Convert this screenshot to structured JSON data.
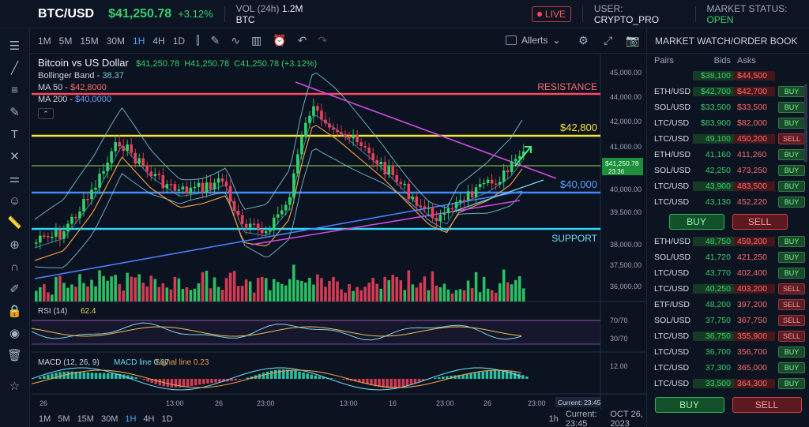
{
  "topbar": {
    "symbol": "BTC/USD",
    "price": "$41,250.78",
    "change": "+3.12%",
    "vol_label": "VOL (24h)",
    "vol_value": "1.2M BTC",
    "live": "LIVE",
    "user_label": "USER:",
    "user_value": "CRYPTO_PRO",
    "status_label": "MARKET STATUS:",
    "status_value": "OPEN"
  },
  "timeframes": [
    "1M",
    "5M",
    "15M",
    "30M",
    "1H",
    "4H",
    "1D"
  ],
  "active_timeframe": "1H",
  "alerts_label": "Allerts",
  "legend": {
    "title": "Bitcoin vs US Dollar",
    "price": "$41,250.78",
    "high": "H41,250.78",
    "close": "C41,250.78 (+3.12%)",
    "bb_label": "Bollinger Band -",
    "bb_value": "38.37",
    "ma50_label": "MA 50 -",
    "ma50_value": "$42,8000",
    "ma200_label": "MA 200 -",
    "ma200_value": "$40,0000"
  },
  "chart_data": {
    "type": "candlestick",
    "y_ticks": [
      "45,000.00",
      "44,000.00",
      "42,000.00",
      "41,000.00",
      "40,000.00",
      "39,500.00",
      "38,000.00",
      "37,500.00",
      "36,000.00"
    ],
    "x_ticks": [
      "26",
      "13:00",
      "26",
      "23:00",
      "13:00",
      "16",
      "23:00",
      "26",
      "23:00"
    ],
    "annotations": {
      "resistance": "RESISTANCE",
      "level_42800": "$42,800",
      "level_40000": "$40,000",
      "support": "SUPPORT"
    },
    "current_tag": "$41,250.78",
    "current_tag_time": "23:36",
    "rsi_label": "RSI (14)",
    "rsi_value": "62.4",
    "rsi_ticks": [
      "70/70",
      "30/70"
    ],
    "macd_label": "MACD (12, 26, 9)",
    "macd_line_label": "MACD line 0.67",
    "signal_line_label": "Signal line 0.23",
    "macd_tick": "12.00",
    "current_time_label": "Current: 23:45"
  },
  "bottombar": {
    "timeframes": [
      "1M",
      "5M",
      "15M",
      "30M",
      "1H",
      "4H",
      "1D"
    ],
    "interval": "1h",
    "current": "Current: 23:45",
    "date": "OCT 26, 2023"
  },
  "panel": {
    "title": "MARKET WATCH/ORDER BOOK",
    "headers": [
      "Pairs",
      "Bids",
      "Asks"
    ],
    "top_row": {
      "bid": "$38,100",
      "ask": "$44,500"
    },
    "rows_a": [
      {
        "pair": "ETH/USD",
        "bid": "$42,700",
        "ask": "$42,700",
        "action": "BUY"
      },
      {
        "pair": "SOL/USD",
        "bid": "$33,500",
        "ask": "$33,500",
        "action": "BUY"
      },
      {
        "pair": "LTC/USD",
        "bid": "$83,900",
        "ask": "$82,000",
        "action": "BUY"
      },
      {
        "pair": "LTC/USD",
        "bid": "49,100",
        "ask": "450,200",
        "action": "SELL"
      },
      {
        "pair": "ETH/USD",
        "bid": "41,160",
        "ask": "411,260",
        "action": "BUY"
      },
      {
        "pair": "SOL/USD",
        "bid": "42,250",
        "ask": "473,250",
        "action": "BUY"
      },
      {
        "pair": "LTC/USD",
        "bid": "43,900",
        "ask": "483,500",
        "action": "BUY"
      },
      {
        "pair": "LTC/USD",
        "bid": "43,130",
        "ask": "452,220",
        "action": "BUY"
      }
    ],
    "buy": "BUY",
    "sell": "SELL",
    "rows_b": [
      {
        "pair": "ETH/USD",
        "bid": "48,750",
        "ask": "459,200",
        "action": "BUY"
      },
      {
        "pair": "SOL/USD",
        "bid": "41,720",
        "ask": "421,250",
        "action": "BUY"
      },
      {
        "pair": "LTC/USD",
        "bid": "43,770",
        "ask": "402,400",
        "action": "BUY"
      },
      {
        "pair": "LTC/USD",
        "bid": "40,250",
        "ask": "403,200",
        "action": "SELL"
      },
      {
        "pair": "ETF/USD",
        "bid": "48,200",
        "ask": "397,200",
        "action": "SELL"
      },
      {
        "pair": "SOL/USD",
        "bid": "37,750",
        "ask": "367,750",
        "action": "SELL"
      },
      {
        "pair": "LTC/USD",
        "bid": "36,750",
        "ask": "355,900",
        "action": "SELL"
      },
      {
        "pair": "LTC/USD",
        "bid": "36,700",
        "ask": "356,700",
        "action": "BUY"
      },
      {
        "pair": "LTC/USD",
        "bid": "37,300",
        "ask": "365,000",
        "action": "BUY"
      },
      {
        "pair": "LTC/USD",
        "bid": "33,500",
        "ask": "364,300",
        "action": "BUY"
      }
    ],
    "buy2": "BUY",
    "sell2": "SELL"
  },
  "colors": {
    "up": "#2fd36a",
    "down": "#e8405a",
    "resistance": "#ff4b5c",
    "yellow": "#f5e535",
    "blue_level": "#3d8bff",
    "support": "#34d3f5",
    "magenta": "#d04be0"
  }
}
